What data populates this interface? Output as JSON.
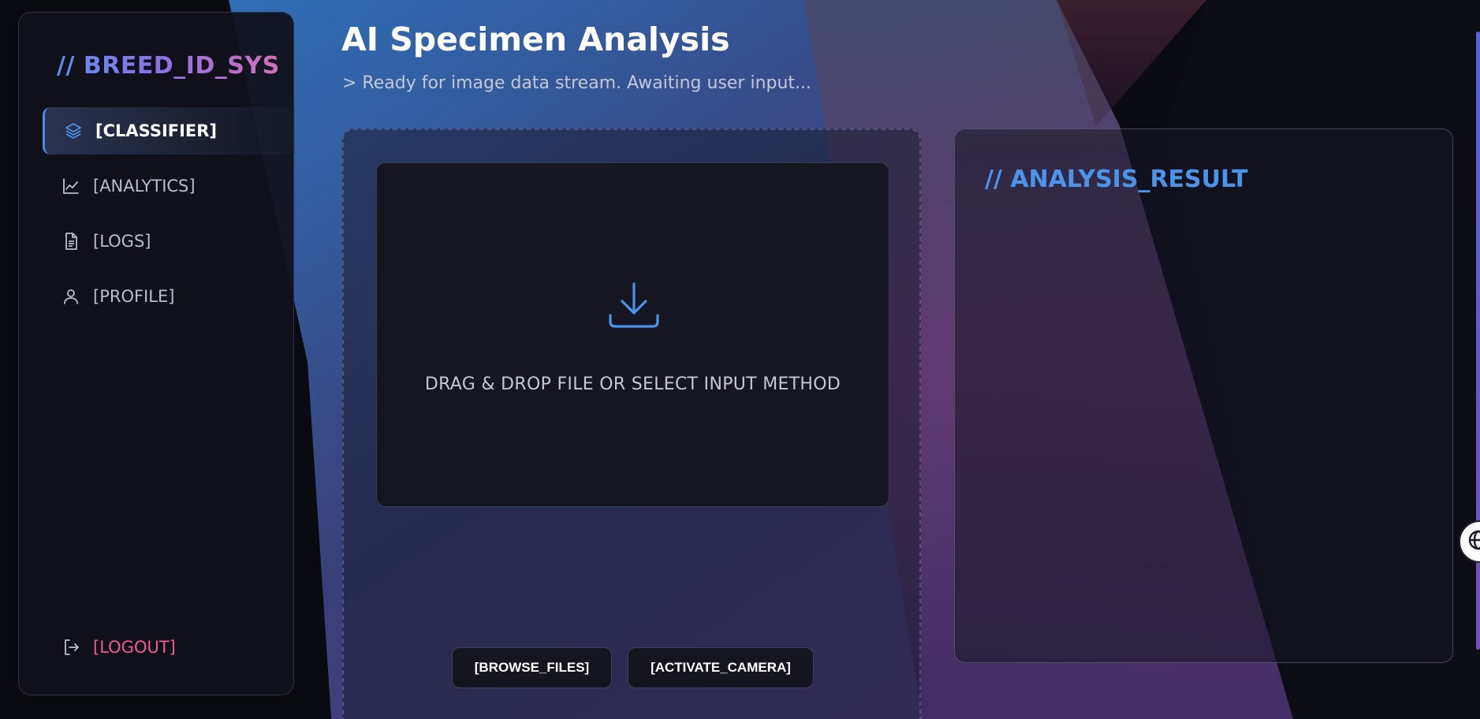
{
  "sidebar": {
    "brand": "// BREED_ID_SYS",
    "items": [
      {
        "label": "[CLASSIFIER]",
        "icon": "layers-icon",
        "active": true
      },
      {
        "label": "[ANALYTICS]",
        "icon": "chart-line-icon",
        "active": false
      },
      {
        "label": "[LOGS]",
        "icon": "document-icon",
        "active": false
      },
      {
        "label": "[PROFILE]",
        "icon": "user-icon",
        "active": false
      }
    ],
    "logout": {
      "label": "[LOGOUT]",
      "icon": "logout-icon"
    }
  },
  "header": {
    "title": "AI Specimen Analysis",
    "subtitle": "> Ready for image data stream. Awaiting user input..."
  },
  "upload": {
    "drop_text": "DRAG & DROP FILE OR SELECT INPUT METHOD",
    "drop_icon": "download-icon",
    "browse_label": "[BROWSE_FILES]",
    "camera_label": "[ACTIVATE_CAMERA]"
  },
  "result": {
    "title": "// ANALYSIS_RESULT"
  },
  "colors": {
    "accent_blue": "#4c93ea",
    "logout_pink": "#ef5d8c",
    "background": "#0b0c12"
  }
}
